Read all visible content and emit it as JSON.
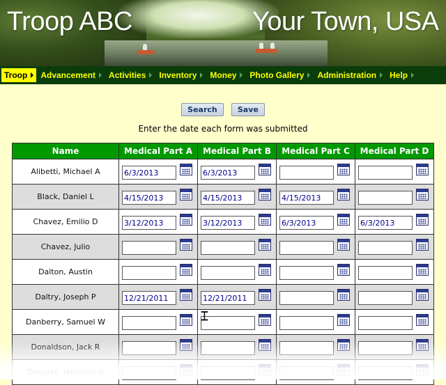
{
  "banner": {
    "title_left": "Troop ABC",
    "title_right": "Your Town, USA"
  },
  "nav": {
    "items": [
      {
        "label": "Troop",
        "active": true
      },
      {
        "label": "Advancement"
      },
      {
        "label": "Activities"
      },
      {
        "label": "Inventory"
      },
      {
        "label": "Money"
      },
      {
        "label": "Photo Gallery"
      },
      {
        "label": "Administration"
      },
      {
        "label": "Help"
      }
    ]
  },
  "toolbar": {
    "search_label": "Search",
    "save_label": "Save"
  },
  "instructions": "Enter the date each form was submitted",
  "table": {
    "headers": [
      "Name",
      "Medical Part A",
      "Medical Part B",
      "Medical Part C",
      "Medical Part D"
    ],
    "rows": [
      {
        "name": "Alibetti, Michael A",
        "dates": [
          "6/3/2013",
          "6/3/2013",
          "",
          ""
        ]
      },
      {
        "name": "Black, Daniel L",
        "dates": [
          "4/15/2013",
          "4/15/2013",
          "4/15/2013",
          ""
        ]
      },
      {
        "name": "Chavez, Emilio D",
        "dates": [
          "3/12/2013",
          "3/12/2013",
          "6/3/2013",
          "6/3/2013"
        ]
      },
      {
        "name": "Chavez, Julio",
        "dates": [
          "",
          "",
          "",
          ""
        ]
      },
      {
        "name": "Dalton, Austin",
        "dates": [
          "",
          "",
          "",
          ""
        ]
      },
      {
        "name": "Daltry, Joseph P",
        "dates": [
          "12/21/2011",
          "12/21/2011",
          "",
          ""
        ]
      },
      {
        "name": "Danberry, Samuel W",
        "dates": [
          "",
          "",
          "",
          ""
        ]
      },
      {
        "name": "Donaldson, Jack R",
        "dates": [
          "",
          "",
          "",
          ""
        ]
      },
      {
        "name": "Douglas, Harrison G",
        "dates": [
          "",
          "",
          "",
          ""
        ]
      }
    ]
  },
  "colors": {
    "nav_bg": "#0b3d0b",
    "nav_text": "#ffff00",
    "header_bg": "#009900",
    "page_bg": "#ffffcc"
  },
  "icons": {
    "calendar": "calendar-icon",
    "cursor": "text-cursor-icon"
  }
}
